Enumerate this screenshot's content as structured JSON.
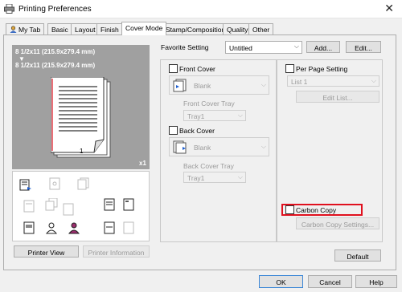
{
  "window": {
    "title": "Printing Preferences"
  },
  "tabs": [
    "My Tab",
    "Basic",
    "Layout",
    "Finish",
    "Cover Mode",
    "Stamp/Composition",
    "Quality",
    "Other"
  ],
  "preview": {
    "line1": "8 1/2x11 (215.9x279.4 mm)",
    "line2": "8 1/2x11 (215.9x279.4 mm)",
    "page_number": "1",
    "copies": "x1",
    "printer_view_label": "Printer View",
    "printer_information_label": "Printer Information"
  },
  "favorite": {
    "label": "Favorite Setting",
    "value": "Untitled",
    "add_label": "Add...",
    "edit_label": "Edit..."
  },
  "front_cover": {
    "label": "Front Cover",
    "value": "Blank",
    "tray_label": "Front Cover Tray",
    "tray_value": "Tray1"
  },
  "back_cover": {
    "label": "Back Cover",
    "value": "Blank",
    "tray_label": "Back Cover Tray",
    "tray_value": "Tray1"
  },
  "per_page": {
    "label": "Per Page Setting",
    "list_value": "List 1",
    "edit_list_label": "Edit List..."
  },
  "carbon_copy": {
    "label": "Carbon Copy",
    "settings_label": "Carbon Copy Settings...",
    "highlight_color": "#e0101e"
  },
  "footer": {
    "default_label": "Default",
    "ok_label": "OK",
    "cancel_label": "Cancel",
    "help_label": "Help"
  }
}
